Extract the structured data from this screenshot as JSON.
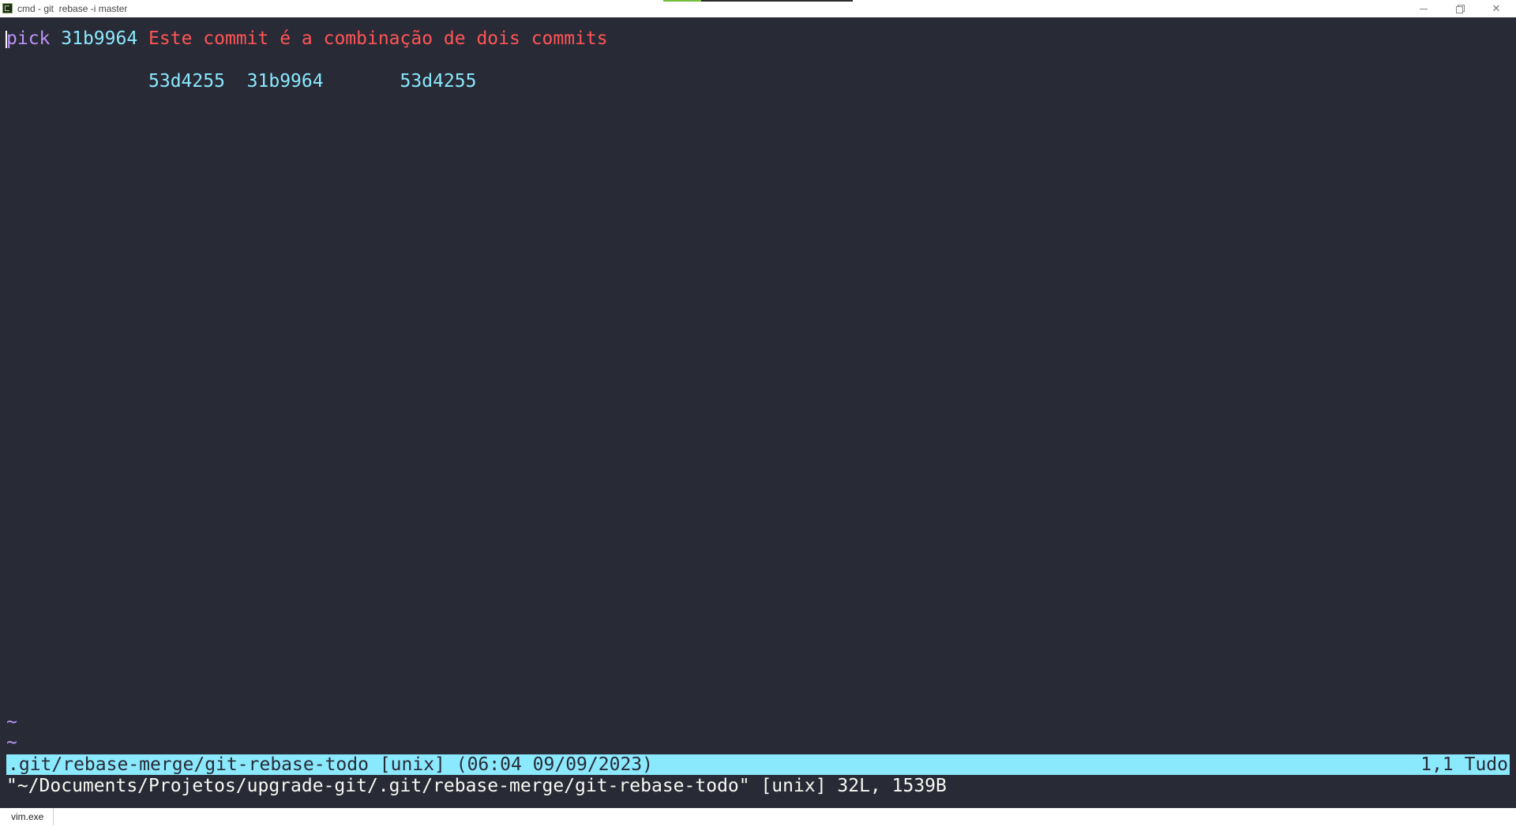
{
  "window": {
    "title": "cmd - git  rebase -i master",
    "icon": "console-icon",
    "controls": [
      "minimize",
      "restore",
      "close"
    ]
  },
  "editor": {
    "line1": {
      "command": "pick",
      "hash": "31b9964",
      "message": "Este commit é a combinação de dois commits"
    },
    "line2": {
      "hash_a": "53d4255",
      "hash_b": "31b9964",
      "hash_c": "53d4255"
    },
    "tilde": "~"
  },
  "statusline": {
    "file": ".git/rebase-merge/git-rebase-todo [unix] (06:04 09/09/2023)",
    "position": "1,1 Tudo"
  },
  "message_line": "\"~/Documents/Projetos/upgrade-git/.git/rebase-merge/git-rebase-todo\" [unix] 32L, 1539B",
  "taskbar": {
    "tab_label": "vim.exe"
  },
  "colors": {
    "background": "#282a36",
    "keyword": "#bd93f9",
    "hash": "#8be9fd",
    "message": "#ff5555",
    "statusline_bg": "#8be9fd"
  }
}
